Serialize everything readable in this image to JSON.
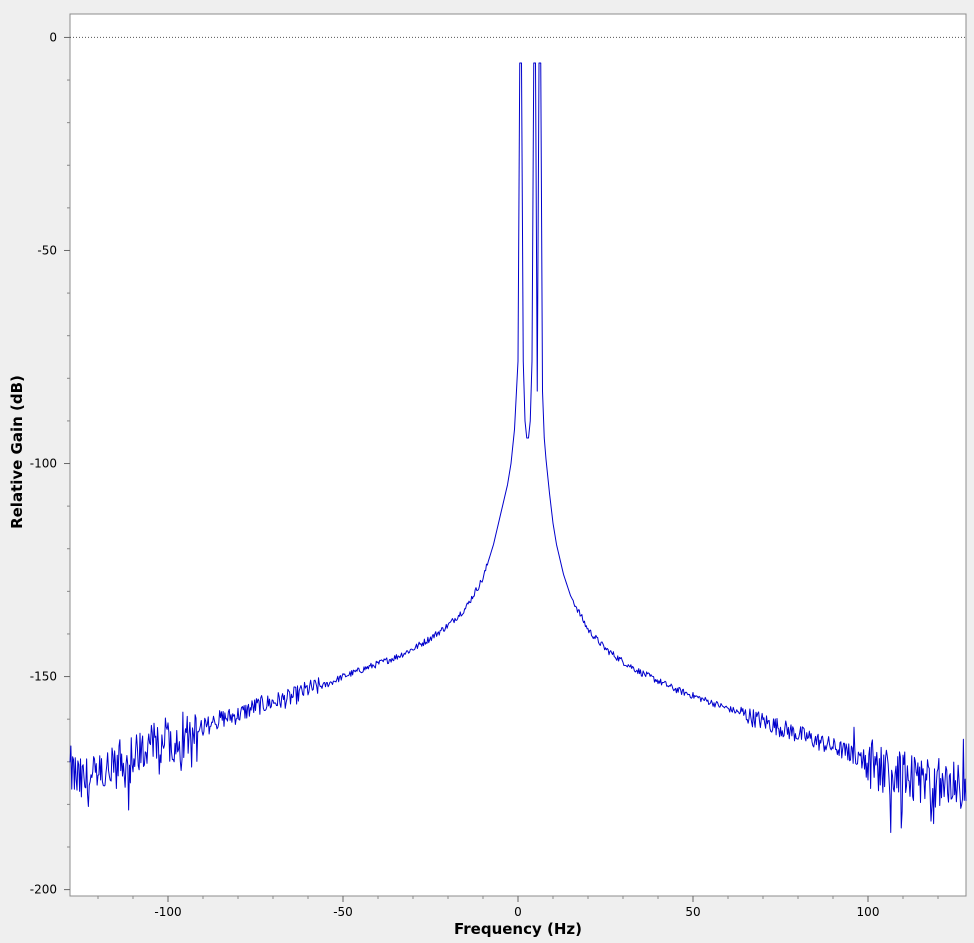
{
  "chart_data": {
    "type": "line",
    "title": "",
    "xlabel": "Frequency (Hz)",
    "ylabel": "Relative Gain (dB)",
    "xlim": [
      -128,
      128
    ],
    "ylim": [
      -201.5,
      5.5
    ],
    "xticks": [
      -100,
      -50,
      0,
      50,
      100
    ],
    "yticks": [
      0,
      -50,
      -100,
      -150,
      -200
    ],
    "x_tick_labels": [
      "-100",
      "-50",
      "0",
      "50",
      "100"
    ],
    "y_tick_labels": [
      "0",
      "-50",
      "-100",
      "-150",
      "-200"
    ],
    "grid": false,
    "legend": "none",
    "reference_line": {
      "y": 0,
      "style": "dotted"
    },
    "series": [
      {
        "color": "#0000cc",
        "x": [
          -128,
          -125,
          -120,
          -115,
          -110,
          -105,
          -100,
          -95,
          -90,
          -85,
          -80,
          -75,
          -70,
          -65,
          -60,
          -55,
          -50,
          -45,
          -40,
          -35,
          -30,
          -25,
          -20,
          -15,
          -10,
          -7,
          -5,
          -3,
          -2,
          -1,
          0,
          0.5,
          1,
          1.5,
          2,
          2.5,
          3,
          3.5,
          4,
          4.5,
          5,
          5.5,
          6,
          6.5,
          7,
          7.5,
          8,
          8.5,
          9,
          10,
          11,
          13,
          15,
          20,
          25,
          30,
          35,
          40,
          45,
          50,
          55,
          60,
          65,
          70,
          75,
          80,
          85,
          90,
          95,
          100,
          105,
          110,
          115,
          120,
          125,
          128
        ],
        "y": [
          -172,
          -175,
          -174,
          -172,
          -169,
          -167,
          -165,
          -164,
          -162,
          -160,
          -159,
          -157,
          -156,
          -155,
          -153,
          -152,
          -150,
          -148.5,
          -147,
          -145.5,
          -143.5,
          -141,
          -138,
          -134,
          -127,
          -119,
          -112,
          -105,
          -100,
          -92,
          -76,
          -6,
          -6,
          -76,
          -90,
          -94,
          -94,
          -90,
          -76,
          -6,
          -6,
          -83,
          -6,
          -6,
          -83,
          -94,
          -99,
          -103,
          -107,
          -114,
          -119,
          -126,
          -131,
          -139,
          -143.5,
          -146.5,
          -149,
          -151,
          -153,
          -154.5,
          -156,
          -157.5,
          -159,
          -160.5,
          -162,
          -163.5,
          -165,
          -166.5,
          -168,
          -170,
          -172,
          -173,
          -174,
          -175,
          -176,
          -177
        ]
      }
    ]
  }
}
